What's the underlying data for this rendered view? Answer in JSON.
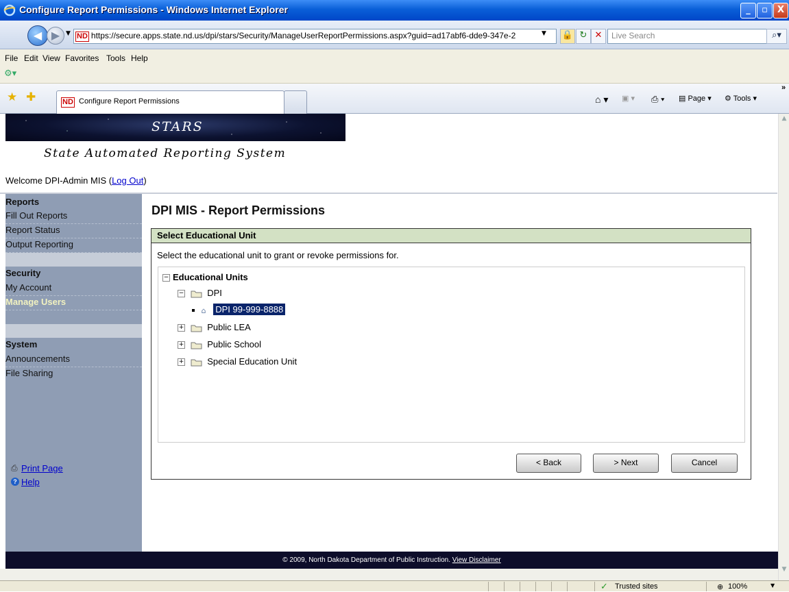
{
  "window": {
    "title": "Configure Report Permissions - Windows Internet Explorer",
    "controls": {
      "minimize": "_",
      "maximize": "▫",
      "close": "X"
    }
  },
  "addressbar": {
    "badge": "ND",
    "url": "https://secure.apps.state.nd.us/dpi/stars/Security/ManageUserReportPermissions.aspx?guid=ad17abf6-dde9-347e-2",
    "search_placeholder": "Live Search"
  },
  "menu": {
    "file": "File",
    "edit": "Edit",
    "view": "View",
    "favorites": "Favorites",
    "tools": "Tools",
    "help": "Help"
  },
  "tabbar": {
    "tab_label": "Configure Report Permissions",
    "tab_badge": "ND",
    "page_label": "Page",
    "tools_label": "Tools"
  },
  "header": {
    "logo_text": "STARS",
    "subtitle": "State Automated Reporting System",
    "welcome_text": "Welcome DPI-Admin MIS (",
    "logout_label": "Log Out",
    "welcome_close": ")"
  },
  "sidebar": {
    "sections": [
      {
        "heading": "Reports",
        "items": [
          "Fill Out Reports",
          "Report Status",
          "Output Reporting"
        ]
      },
      {
        "heading": "Security",
        "items": [
          "My Account",
          "Manage Users"
        ]
      },
      {
        "heading": "System",
        "items": [
          "Announcements",
          "File Sharing"
        ]
      }
    ],
    "selected_item": "Manage Users",
    "print_label": "Print Page",
    "help_label": "Help"
  },
  "main": {
    "page_title": "DPI MIS - Report Permissions",
    "panel_title": "Select Educational Unit",
    "instructions": "Select the educational unit to grant or revoke permissions for.",
    "tree": {
      "root": "Educational Units",
      "children": [
        "DPI",
        "Public LEA",
        "Public School",
        "Special Education Unit"
      ],
      "dpi_child": "DPI 99-999-8888"
    },
    "buttons": {
      "back": "< Back",
      "next": "> Next",
      "cancel": "Cancel"
    }
  },
  "footer": {
    "copyright": "© 2009, North Dakota Department of Public Instruction. ",
    "disclaimer_label": "View Disclaimer"
  },
  "statusbar": {
    "zone": "Trusted sites",
    "zoom": "100%"
  },
  "colors": {
    "title_bar": "#0a5fd8",
    "sidebar_bg": "#8f9db4",
    "panel_header_bg": "#d3e1c4",
    "footer_bg": "#0d0d2a",
    "tree_selection": "#0a246a"
  }
}
